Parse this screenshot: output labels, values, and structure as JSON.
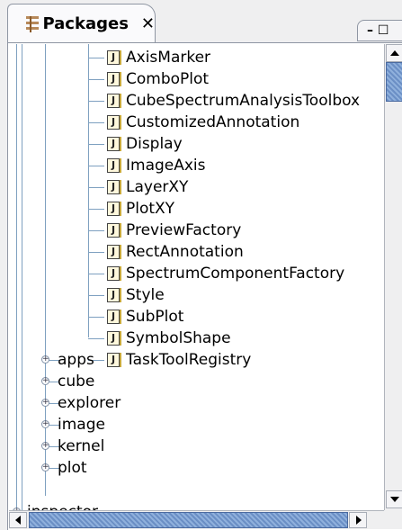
{
  "tab": {
    "title": "Packages",
    "close": "✕",
    "window_controls": "– ☐"
  },
  "classes": [
    {
      "label": "AxisMarker",
      "icon": "J"
    },
    {
      "label": "ComboPlot",
      "icon": "J"
    },
    {
      "label": "CubeSpectrumAnalysisToolbox",
      "icon": "J"
    },
    {
      "label": "CustomizedAnnotation",
      "icon": "J"
    },
    {
      "label": "Display",
      "icon": "J"
    },
    {
      "label": "ImageAxis",
      "icon": "J"
    },
    {
      "label": "LayerXY",
      "icon": "J"
    },
    {
      "label": "PlotXY",
      "icon": "J"
    },
    {
      "label": "PreviewFactory",
      "icon": "J"
    },
    {
      "label": "RectAnnotation",
      "icon": "J"
    },
    {
      "label": "SpectrumComponentFactory",
      "icon": "J"
    },
    {
      "label": "Style",
      "icon": "J"
    },
    {
      "label": "SubPlot",
      "icon": "J"
    },
    {
      "label": "SymbolShape",
      "icon": "J"
    },
    {
      "label": "TaskToolRegistry",
      "icon": "J"
    }
  ],
  "packages": [
    {
      "label": "apps"
    },
    {
      "label": "cube"
    },
    {
      "label": "explorer"
    },
    {
      "label": "image"
    },
    {
      "label": "kernel"
    },
    {
      "label": "plot"
    }
  ],
  "partial_package": {
    "label": "inspector"
  },
  "icons": {
    "tab": "package-view-icon",
    "class": "java-class-file-icon",
    "expand": "expand-plus-icon"
  },
  "colors": {
    "tree_line": "#7ea0c0",
    "scroll_thumb": "#6b8fc5"
  }
}
